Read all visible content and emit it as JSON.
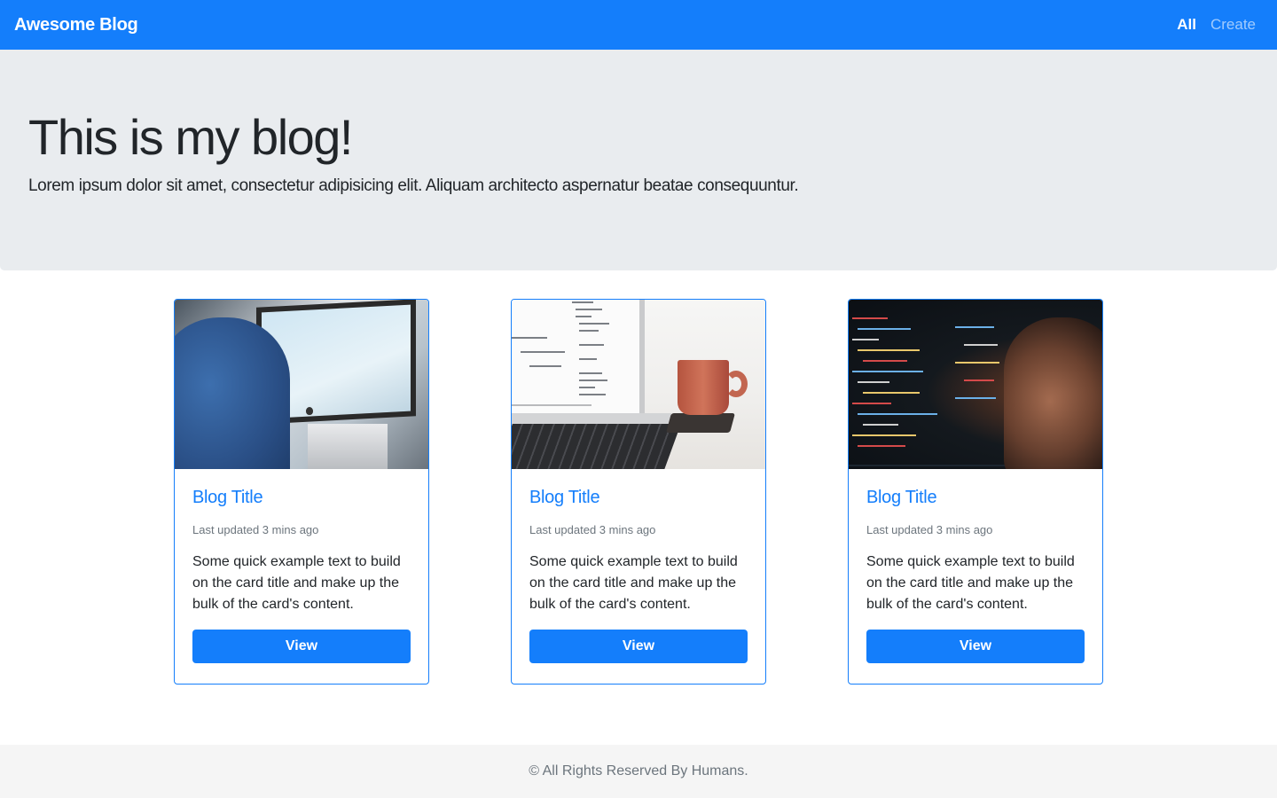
{
  "navbar": {
    "brand": "Awesome Blog",
    "links": [
      {
        "label": "All",
        "active": true
      },
      {
        "label": "Create",
        "active": false
      }
    ],
    "color": "#147efb"
  },
  "hero": {
    "title": "This is my blog!",
    "lead": "Lorem ipsum dolor sit amet, consectetur adipisicing elit. Aliquam architecto aspernatur beatae consequuntur."
  },
  "cards": [
    {
      "image": "person-at-computer-photo",
      "title": "Blog Title",
      "meta": "Last updated 3 mins ago",
      "text": "Some quick example text to build on the card title and make up the bulk of the card's content.",
      "button": "View"
    },
    {
      "image": "laptop-and-coffee-cup-photo",
      "title": "Blog Title",
      "meta": "Last updated 3 mins ago",
      "text": "Some quick example text to build on the card title and make up the bulk of the card's content.",
      "button": "View"
    },
    {
      "image": "dark-code-screen-photo",
      "title": "Blog Title",
      "meta": "Last updated 3 mins ago",
      "text": "Some quick example text to build on the card title and make up the bulk of the card's content.",
      "button": "View"
    }
  ],
  "footer": {
    "text": "© All Rights Reserved By Humans."
  }
}
